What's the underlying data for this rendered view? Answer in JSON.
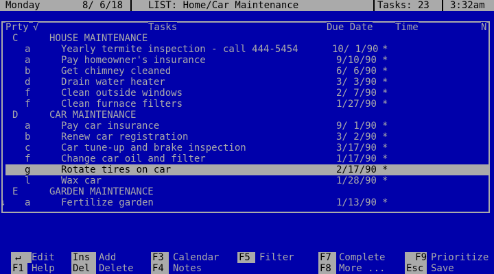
{
  "status": {
    "day": "Monday",
    "date": "8/ 6/18",
    "list": "LIST: Home/Car Maintenance",
    "tasks": "Tasks: 23",
    "time": "3:32am"
  },
  "columns": {
    "prty": "Prty",
    "check": "√",
    "tasks": "Tasks",
    "due": "Due Date",
    "time": "Time",
    "n": "N"
  },
  "rows": [
    {
      "prty": "C",
      "task": "HOUSE MAINTENANCE",
      "due": "",
      "mark": "",
      "type": "group"
    },
    {
      "prty": "a",
      "task": "Yearly termite inspection - call 444-5454",
      "due": "10/ 1/90",
      "mark": "*",
      "type": "task"
    },
    {
      "prty": "a",
      "task": "Pay homeowner's insurance",
      "due": "9/10/90",
      "mark": "*",
      "type": "task"
    },
    {
      "prty": "b",
      "task": "Get chimney cleaned",
      "due": "6/ 6/90",
      "mark": "*",
      "type": "task"
    },
    {
      "prty": "d",
      "task": "Drain water heater",
      "due": "3/ 3/90",
      "mark": "*",
      "type": "task"
    },
    {
      "prty": "f",
      "task": "Clean outside windows",
      "due": "2/ 7/90",
      "mark": "*",
      "type": "task"
    },
    {
      "prty": "f",
      "task": "Clean furnace filters",
      "due": "1/27/90",
      "mark": "*",
      "type": "task"
    },
    {
      "prty": "D",
      "task": "CAR MAINTENANCE",
      "due": "",
      "mark": "",
      "type": "group"
    },
    {
      "prty": "a",
      "task": "Pay car insurance",
      "due": "9/ 1/90",
      "mark": "*",
      "type": "task"
    },
    {
      "prty": "b",
      "task": "Renew car registration",
      "due": "3/ 2/90",
      "mark": "*",
      "type": "task"
    },
    {
      "prty": "c",
      "task": "Car tune-up and brake inspection",
      "due": "3/17/90",
      "mark": "*",
      "type": "task"
    },
    {
      "prty": "f",
      "task": "Change car oil and filter",
      "due": "1/17/90",
      "mark": "*",
      "type": "task"
    },
    {
      "prty": "g",
      "task": "Rotate tires on car",
      "due": "2/17/90",
      "mark": "*",
      "type": "task",
      "selected": true
    },
    {
      "prty": "l",
      "task": "Wax car",
      "due": "1/28/90",
      "mark": "*",
      "type": "task"
    },
    {
      "prty": "E",
      "task": "GARDEN MAINTENANCE",
      "due": "",
      "mark": "",
      "type": "group"
    },
    {
      "prty": "a",
      "task": "Fertilize garden",
      "due": "1/13/90",
      "mark": "*",
      "type": "task"
    }
  ],
  "scroll_indicator": "↓",
  "fkeys": {
    "enter_key": "↵",
    "edit": "Edit",
    "f1_key": "F1",
    "help": "Help",
    "ins_key": "Ins",
    "add": "Add",
    "del_key": "Del",
    "delete": "Delete",
    "f3_key": "F3",
    "calendar": "Calendar",
    "f4_key": "F4",
    "notes": "Notes",
    "f5_key": "F5",
    "filter": "Filter",
    "f7_key": "F7",
    "complete": "Complete",
    "f8_key": "F8",
    "more": "More ...",
    "f9_key": "F9",
    "prioritize": "Prioritize",
    "esc_key": "Esc",
    "save": "Save"
  },
  "colors": {
    "background": "#0000aa",
    "foreground": "#aaaaaa",
    "highlight": "#aaaaaa"
  }
}
